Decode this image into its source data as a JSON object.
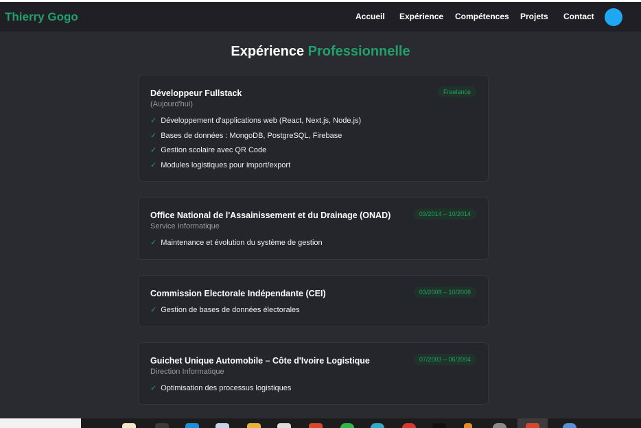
{
  "nav": {
    "brand": "Thierry Gogo",
    "links": [
      "Accueil",
      "Expérience",
      "Compétences",
      "Projets",
      "Contact"
    ]
  },
  "page": {
    "title_main": "Expérience",
    "title_accent": "Professionnelle"
  },
  "experiences": [
    {
      "title": "Développeur Fullstack",
      "subtitle": "(Aujourd'hui)",
      "badge": "Freelance",
      "items": [
        "Développement d'applications web (React, Next.js, Node.js)",
        "Bases de données : MongoDB, PostgreSQL, Firebase",
        "Gestion scolaire avec QR Code",
        "Modules logistiques pour import/export"
      ]
    },
    {
      "title": "Office National de l'Assainissement et du Drainage (ONAD)",
      "subtitle": "Service Informatique",
      "badge": "03/2014 – 10/2014",
      "items": [
        "Maintenance et évolution du système de gestion"
      ]
    },
    {
      "title": "Commission Electorale Indépendante (CEI)",
      "subtitle": "",
      "badge": "03/2008 – 10/2008",
      "items": [
        "Gestion de bases de données électorales"
      ]
    },
    {
      "title": "Guichet Unique Automobile – Côte d'Ivoire Logistique",
      "subtitle": "Direction Informatique",
      "badge": "07/2003 – 06/2004",
      "items": [
        "Optimisation des processus logistiques"
      ]
    }
  ],
  "colors": {
    "accent": "#22a06b",
    "background": "#2a2b30",
    "navbar": "#1f1f25",
    "avatar": "#1ea7f2"
  }
}
